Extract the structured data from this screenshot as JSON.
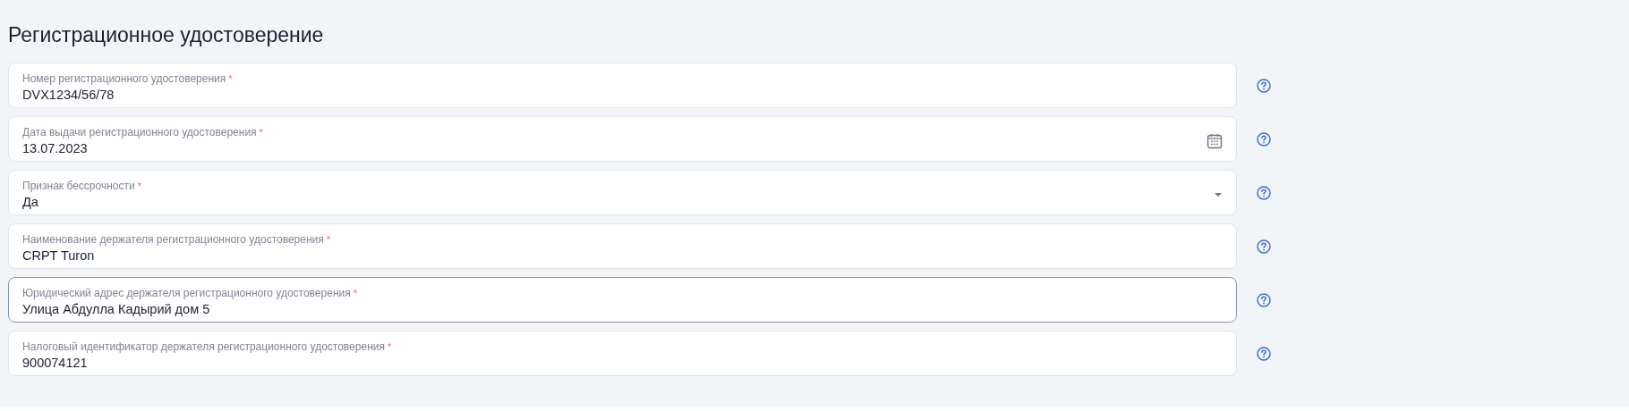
{
  "section_title": "Регистрационное удостоверение",
  "fields": [
    {
      "kind": "text",
      "label": "Номер регистрационного удостоверения",
      "required_mark": "*",
      "value": "DVX1234/56/78",
      "focused": false
    },
    {
      "kind": "date",
      "label": "Дата выдачи регистрационного удостоверения",
      "required_mark": "*",
      "value": "13.07.2023",
      "focused": false
    },
    {
      "kind": "select",
      "label": "Признак бессрочности",
      "required_mark": "*",
      "value": "Да",
      "focused": false
    },
    {
      "kind": "text",
      "label": "Наименование держателя регистрационного удостоверения",
      "required_mark": "*",
      "value": "CRPT Turon",
      "focused": false
    },
    {
      "kind": "text",
      "label": "Юридический адрес держателя регистрационного удостоверения",
      "required_mark": "*",
      "value": "Улица Абдулла Кадырий дом 5",
      "focused": true
    },
    {
      "kind": "text",
      "label": "Налоговый идентификатор держателя регистрационного удостоверения",
      "required_mark": "*",
      "value": "900074121",
      "focused": false
    }
  ]
}
